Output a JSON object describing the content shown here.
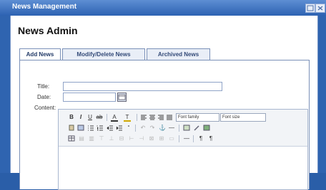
{
  "window": {
    "title": "News Management"
  },
  "page": {
    "title": "News Admin"
  },
  "tabs": [
    {
      "label": "Add News",
      "active": true
    },
    {
      "label": "Modify/Delete News",
      "active": false
    },
    {
      "label": "Archived News",
      "active": false
    }
  ],
  "form": {
    "title_label": "Title:",
    "date_label": "Date:",
    "content_label": "Content:"
  },
  "editor": {
    "font_family_label": "Font family",
    "font_size_label": "Font size"
  }
}
